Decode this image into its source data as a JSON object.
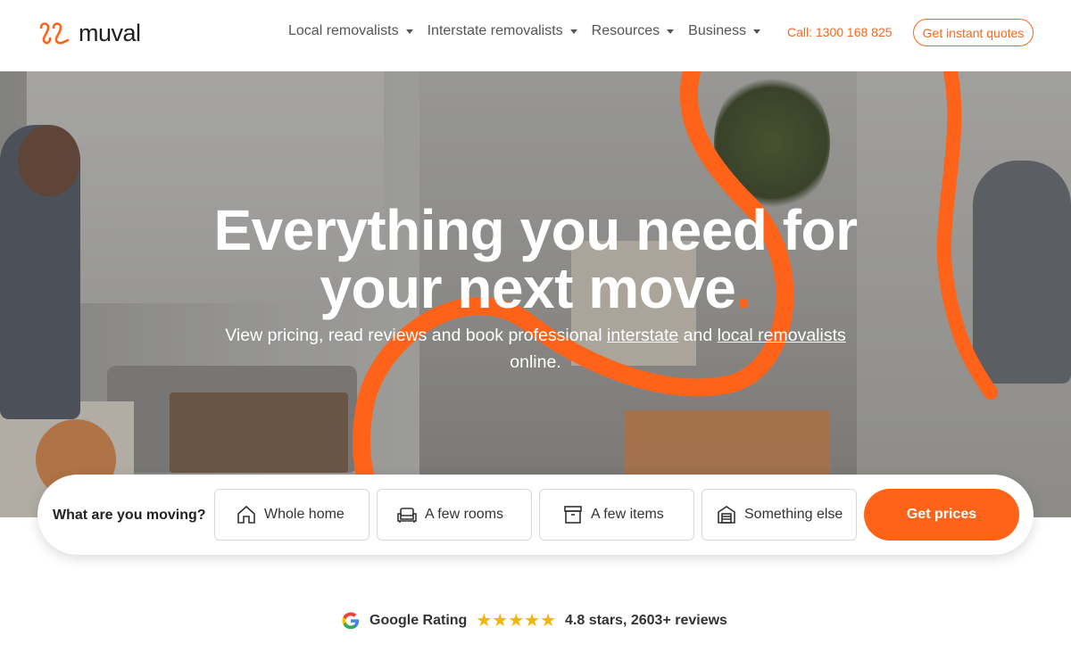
{
  "brand": {
    "name": "muval",
    "accent": "#ff6319"
  },
  "nav": {
    "items": [
      {
        "label": "Local removalists"
      },
      {
        "label": "Interstate removalists"
      },
      {
        "label": "Resources"
      },
      {
        "label": "Business"
      }
    ],
    "call_label": "Call: 1300 168 825",
    "quote_button": "Get instant quotes"
  },
  "hero": {
    "title_line1": "Everything you need for",
    "title_line2": "your next move",
    "title_dot": ".",
    "subtitle_pre": "View pricing, read reviews and book professional ",
    "subtitle_link1": "interstate",
    "subtitle_mid": " and ",
    "subtitle_link2": "local removalists",
    "subtitle_post": " online."
  },
  "search": {
    "label": "What are you moving?",
    "options": [
      {
        "label": "Whole home",
        "icon": "house-icon"
      },
      {
        "label": "A few rooms",
        "icon": "sofa-icon"
      },
      {
        "label": "A few items",
        "icon": "box-icon"
      },
      {
        "label": "Something else",
        "icon": "storage-icon"
      }
    ],
    "cta": "Get prices"
  },
  "rating": {
    "label": "Google Rating",
    "stars": 5,
    "star_color": "#f5b400",
    "text": "4.8 stars, 2603+ reviews"
  }
}
